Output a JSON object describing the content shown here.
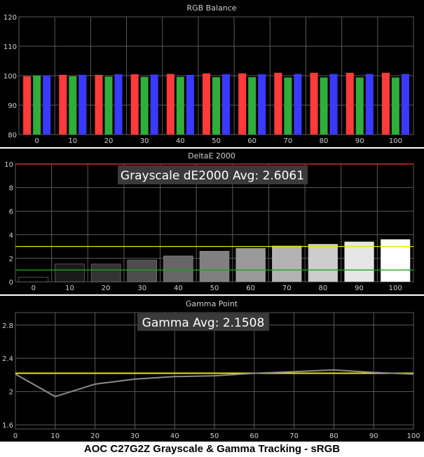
{
  "colors": {
    "background": "#000000",
    "grid": "#5a5a5a",
    "text": "#d0d0d0",
    "red": "#ff3a3a",
    "green": "#2fae3a",
    "blue": "#3a3aff",
    "redline": "#ff3030",
    "yellow": "#e6e600",
    "greenline": "#1fa01f",
    "gammaline": "#8c8c8c",
    "annot_bg": "#3a3a3a",
    "annot_text": "#ffffff"
  },
  "caption": "AOC C27G2Z Grayscale & Gamma Tracking - sRGB",
  "chart_data": [
    {
      "type": "bar",
      "title": "RGB Balance",
      "categories": [
        "0",
        "10",
        "20",
        "30",
        "40",
        "50",
        "60",
        "70",
        "80",
        "90",
        "100"
      ],
      "ylim": [
        80,
        120
      ],
      "yticks": [
        80,
        90,
        100,
        110,
        120
      ],
      "grid": true,
      "series": [
        {
          "color": "red",
          "values": [
            99.8,
            100.3,
            100.3,
            100.5,
            100.6,
            100.8,
            100.8,
            101.0,
            101.0,
            101.0,
            101.0
          ]
        },
        {
          "color": "green",
          "values": [
            100.1,
            99.8,
            99.7,
            99.6,
            99.6,
            99.5,
            99.5,
            99.4,
            99.4,
            99.4,
            99.4
          ]
        },
        {
          "color": "blue",
          "values": [
            100.1,
            100.3,
            100.5,
            100.4,
            100.3,
            100.5,
            100.5,
            100.6,
            100.6,
            100.6,
            100.6
          ]
        }
      ]
    },
    {
      "type": "bar",
      "title": "DeltaE 2000",
      "annotation": "Grayscale dE2000 Avg: 2.6061",
      "categories": [
        "0",
        "10",
        "20",
        "30",
        "40",
        "50",
        "60",
        "70",
        "80",
        "90",
        "100"
      ],
      "values": [
        0.4,
        1.5,
        1.5,
        1.85,
        2.2,
        2.6,
        2.85,
        3.05,
        3.2,
        3.4,
        3.6
      ],
      "ylim": [
        0,
        10
      ],
      "yticks": [
        0,
        2,
        4,
        6,
        8,
        10
      ],
      "reference_lines": [
        {
          "value": 10,
          "color": "redline"
        },
        {
          "value": 3,
          "color": "yellow"
        },
        {
          "value": 1,
          "color": "greenline"
        }
      ],
      "grid": true
    },
    {
      "type": "line",
      "title": "Gamma Point",
      "annotation": "Gamma Avg: 2.1508",
      "x": [
        0,
        10,
        20,
        30,
        40,
        50,
        60,
        70,
        80,
        90,
        100
      ],
      "y": [
        2.21,
        1.94,
        2.09,
        2.15,
        2.18,
        2.19,
        2.22,
        2.24,
        2.26,
        2.23,
        2.21
      ],
      "target": 2.22,
      "xlim": [
        0,
        100
      ],
      "ylim": [
        1.55,
        2.95
      ],
      "yticks": [
        1.6,
        2.0,
        2.4,
        2.8
      ],
      "ytick_labels": [
        "1.6",
        "2",
        "2.4",
        "2.8"
      ],
      "xticks": [
        0,
        10,
        20,
        30,
        40,
        50,
        60,
        70,
        80,
        90,
        100
      ],
      "grid": true
    }
  ]
}
